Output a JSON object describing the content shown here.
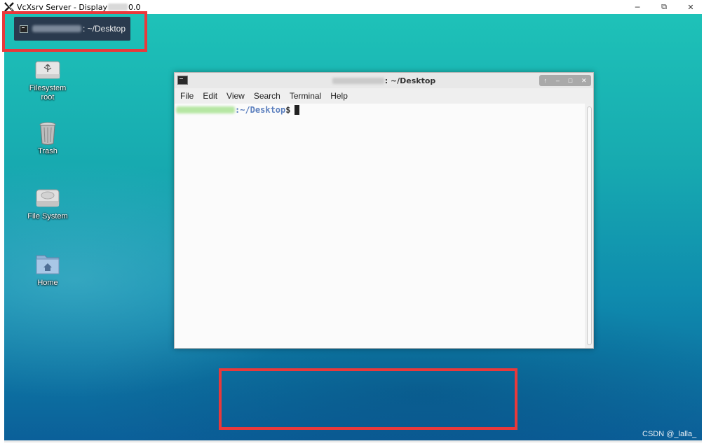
{
  "window": {
    "title_prefix": "VcXsrv Server - Display ",
    "title_suffix": "0.0",
    "minimize_glyph": "─",
    "restore_glyph": "⧉",
    "close_glyph": "✕"
  },
  "taskbar": {
    "button_label": ": ~/Desktop"
  },
  "desktop_icons": [
    {
      "icon": "usb-drive-icon",
      "label_line1": "Filesystem",
      "label_line2": "root"
    },
    {
      "icon": "trash-icon",
      "label_line1": "Trash",
      "label_line2": ""
    },
    {
      "icon": "hard-disk-icon",
      "label_line1": "File System",
      "label_line2": ""
    },
    {
      "icon": "home-folder-icon",
      "label_line1": "Home",
      "label_line2": ""
    }
  ],
  "terminal": {
    "title": ": ~/Desktop",
    "controls": [
      "↑",
      "–",
      "□",
      "✕"
    ],
    "menu": [
      "File",
      "Edit",
      "View",
      "Search",
      "Terminal",
      "Help"
    ],
    "prompt_path": ":~/Desktop",
    "prompt_symbol": "$"
  },
  "watermark": "CSDN @_lalla_",
  "colors": {
    "highlight": "#e9393b",
    "desktop_top": "#1ec2b8",
    "desktop_bottom": "#0b5f99",
    "prompt_path": "#5b7fbe"
  }
}
